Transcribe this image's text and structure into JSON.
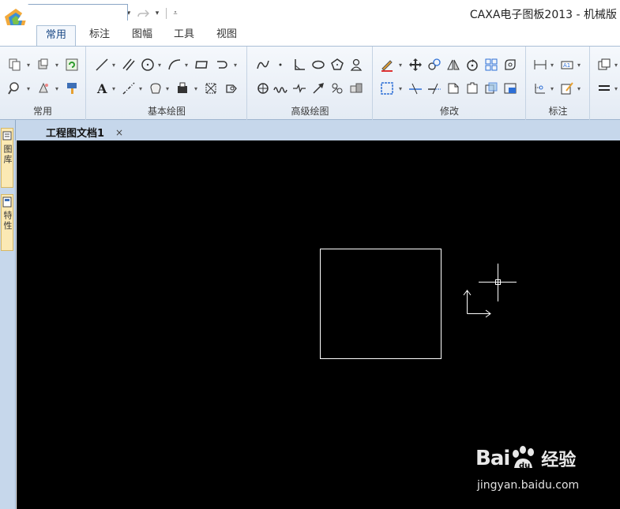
{
  "window": {
    "title": "CAXA电子图板2013 - 机械版"
  },
  "quick_access": [
    {
      "icon": "new-file-icon"
    },
    {
      "icon": "open-folder-icon"
    },
    {
      "icon": "save-icon"
    },
    {
      "icon": "print-icon"
    },
    {
      "icon": "undo-icon"
    },
    {
      "icon": "redo-icon"
    },
    {
      "icon": "customize-qat-icon"
    }
  ],
  "tabs": [
    {
      "label": "常用",
      "active": true
    },
    {
      "label": "标注",
      "active": false
    },
    {
      "label": "图幅",
      "active": false
    },
    {
      "label": "工具",
      "active": false
    },
    {
      "label": "视图",
      "active": false
    }
  ],
  "ribbon_groups": [
    {
      "label": "常用"
    },
    {
      "label": "基本绘图"
    },
    {
      "label": "高级绘图"
    },
    {
      "label": "修改"
    },
    {
      "label": "标注"
    }
  ],
  "document_tab": {
    "label": "工程图文档1",
    "close": "×"
  },
  "side_tabs": [
    {
      "label": "图库",
      "icon": "library-icon"
    },
    {
      "label": "特性",
      "icon": "properties-icon"
    }
  ],
  "colors": {
    "canvas_bg": "#000000",
    "ribbon_bg": "#e4ebf4",
    "accent": "#1c4a86",
    "drawing_line": "#ffffff"
  },
  "watermark": {
    "brand": "Bai",
    "brand2": "经验",
    "url": "jingyan.baidu.com"
  }
}
